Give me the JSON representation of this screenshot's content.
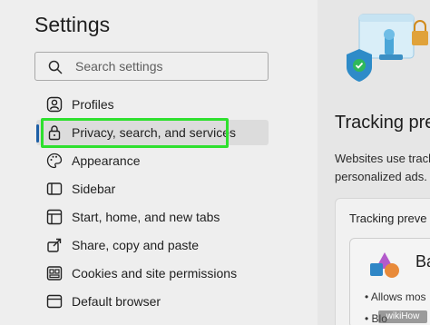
{
  "settings": {
    "title": "Settings",
    "search": {
      "placeholder": "Search settings",
      "icon": "search-icon"
    }
  },
  "sidebar": {
    "items": [
      {
        "label": "Profiles",
        "icon": "profile-icon",
        "active": false
      },
      {
        "label": "Privacy, search, and services",
        "icon": "lock-icon",
        "active": true
      },
      {
        "label": "Appearance",
        "icon": "palette-icon",
        "active": false
      },
      {
        "label": "Sidebar",
        "icon": "sidebar-icon",
        "active": false
      },
      {
        "label": "Start, home, and new tabs",
        "icon": "home-icon",
        "active": false
      },
      {
        "label": "Share, copy and paste",
        "icon": "share-icon",
        "active": false
      },
      {
        "label": "Cookies and site permissions",
        "icon": "cookie-permissions-icon",
        "active": false
      },
      {
        "label": "Default browser",
        "icon": "browser-icon",
        "active": false
      }
    ]
  },
  "main": {
    "tracking_title": "Tracking pre",
    "desc_line1": "Websites use track",
    "desc_line2": "personalized ads.",
    "card_title": "Tracking preve",
    "option_label": "Ba",
    "bullet1": "Allows mos",
    "bullet2": "Blo"
  },
  "watermark": "wikiHow",
  "colors": {
    "highlight": "#2ee02e",
    "active_indicator": "#1d5fa6",
    "background": "#eeeeee"
  }
}
